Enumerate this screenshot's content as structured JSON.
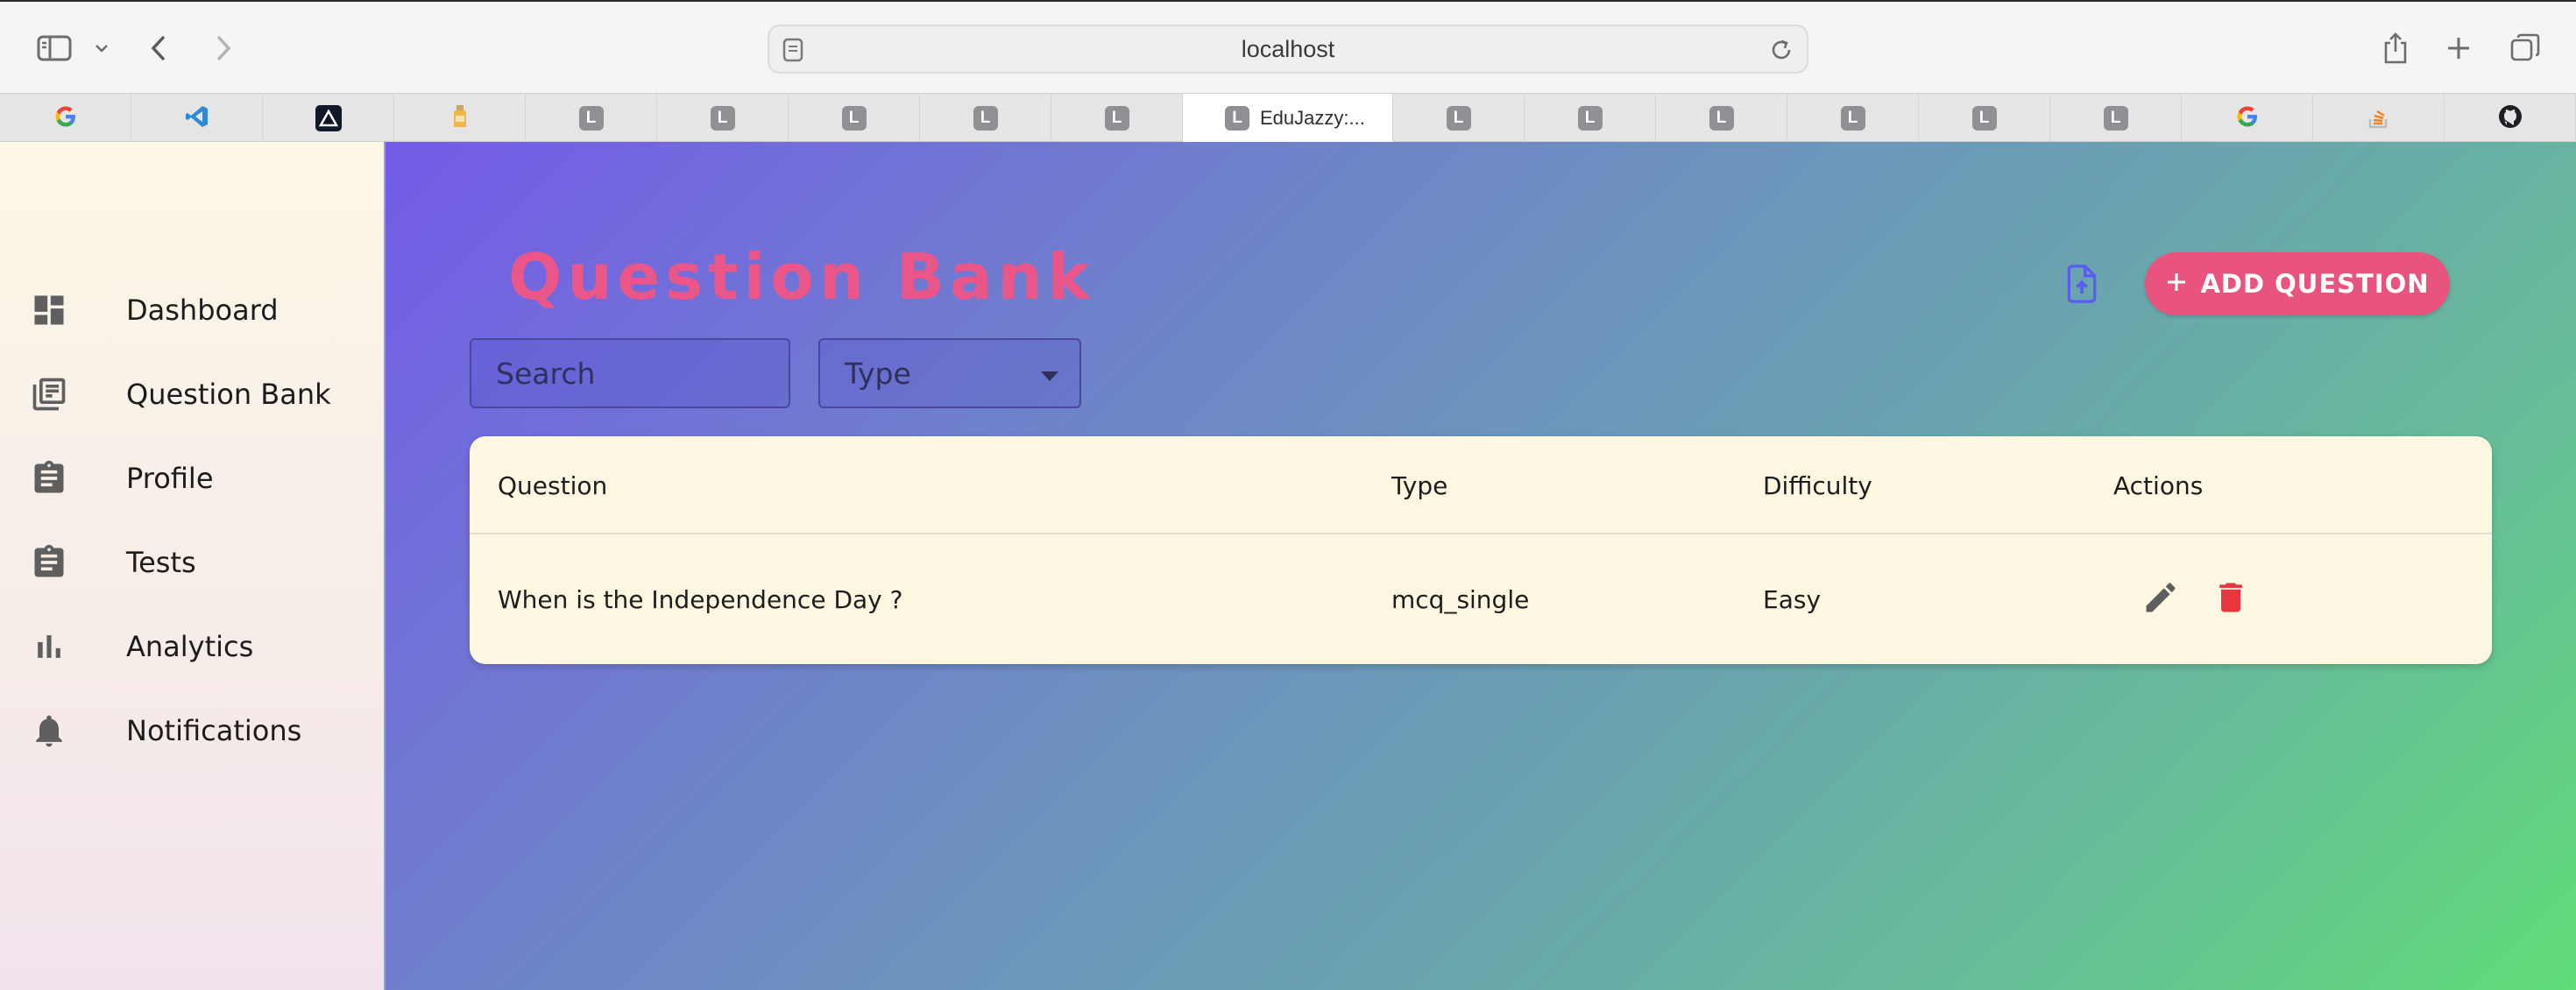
{
  "browser": {
    "url": "localhost",
    "tabs": [
      {
        "icon": "google-icon"
      },
      {
        "icon": "vscode-icon"
      },
      {
        "icon": "app-icon"
      },
      {
        "icon": "bottle-icon"
      },
      {
        "icon": "letter-l-icon",
        "letter": "L"
      },
      {
        "icon": "letter-l-icon",
        "letter": "L"
      },
      {
        "icon": "letter-l-icon",
        "letter": "L"
      },
      {
        "icon": "letter-l-icon",
        "letter": "L"
      },
      {
        "icon": "letter-l-icon",
        "letter": "L"
      },
      {
        "icon": "letter-l-icon",
        "letter": "L",
        "title": "EduJazzy:...",
        "active": true
      },
      {
        "icon": "letter-l-icon",
        "letter": "L"
      },
      {
        "icon": "letter-l-icon",
        "letter": "L"
      },
      {
        "icon": "letter-l-icon",
        "letter": "L"
      },
      {
        "icon": "letter-l-icon",
        "letter": "L"
      },
      {
        "icon": "letter-l-icon",
        "letter": "L"
      },
      {
        "icon": "letter-l-icon",
        "letter": "L"
      },
      {
        "icon": "google-icon"
      },
      {
        "icon": "stackoverflow-icon"
      },
      {
        "icon": "github-icon"
      }
    ]
  },
  "sidebar": {
    "items": [
      {
        "label": "Dashboard",
        "icon": "dashboard-icon"
      },
      {
        "label": "Question Bank",
        "icon": "library-books-icon"
      },
      {
        "label": "Profile",
        "icon": "clipboard-icon"
      },
      {
        "label": "Tests",
        "icon": "clipboard-icon"
      },
      {
        "label": "Analytics",
        "icon": "bar-chart-icon"
      },
      {
        "label": "Notifications",
        "icon": "bell-icon"
      }
    ]
  },
  "main": {
    "title": "Question Bank",
    "add_button_label": "ADD QUESTION",
    "search_placeholder": "Search",
    "type_select_value": "Type",
    "table": {
      "columns": [
        "Question",
        "Type",
        "Difficulty",
        "Actions"
      ],
      "rows": [
        {
          "question": "When is the Independence Day ?",
          "type": "mcq_single",
          "difficulty": "Easy"
        }
      ]
    }
  },
  "colors": {
    "accent_pink": "#e9547e",
    "title_pink": "#ea5688",
    "delete_red": "#e8363f",
    "upload_blue": "#5b5cf0",
    "table_bg": "#fdf6e1"
  }
}
